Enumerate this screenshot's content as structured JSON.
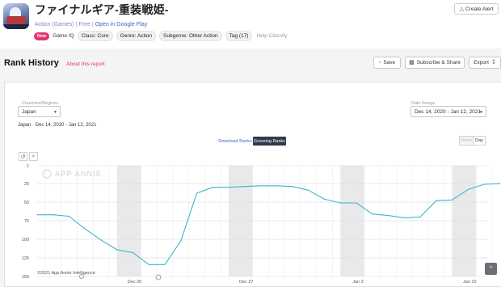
{
  "app": {
    "title": "ファイナルギア-重装戦姫-",
    "category": "Action (Games)",
    "price": "Free",
    "store_link": "Open in Google Play",
    "new_badge": "New",
    "game_iq_label": "Game IQ",
    "tags": [
      "Class: Core",
      "Genre: Action",
      "Subgenre: Other Action",
      "Tag (17)"
    ],
    "help_classify": "Help Classify",
    "create_alert": "Create Alert"
  },
  "section": {
    "title": "Rank History",
    "about": "About this report",
    "save": "Save",
    "subscribe_share": "Subscribe & Share",
    "export": "Export"
  },
  "filters": {
    "country_label": "Countries/Regions",
    "country_value": "Japan",
    "date_label": "Date Range",
    "date_value": "Dec 14, 2020 - Jan 12, 2021",
    "summary": "Japan · Dec 14, 2020 - Jan 12, 2021"
  },
  "rank_toggle": [
    "Download Ranks",
    "Grossing Ranks"
  ],
  "period": [
    "Week",
    "Day"
  ],
  "icons": {
    "alert": "bell-icon",
    "save": "bookmark-icon",
    "share": "share-icon",
    "export": "download-icon",
    "reset": "undo-icon",
    "zoom": "zoom-icon",
    "scroll": "chevron-up-icon"
  },
  "colors": {
    "line": "#3fb5c6",
    "weekend": "#e9e9ec",
    "accent": "#e6356b",
    "active_toggle": "#2f3b4a"
  },
  "chart_data": {
    "type": "line",
    "watermark": "APP ANNIE",
    "credit": "©2021 App Annie Intelligence",
    "y_inverted": true,
    "ylim": [
      1,
      150
    ],
    "y_ticks": [
      1,
      25,
      50,
      75,
      100,
      125,
      150
    ],
    "x_tick_labels": [
      "Dec 20",
      "Dec 27",
      "Jan 3",
      "Jan 10"
    ],
    "dates": [
      "Dec 14",
      "Dec 15",
      "Dec 16",
      "Dec 17",
      "Dec 18",
      "Dec 19",
      "Dec 20",
      "Dec 21",
      "Dec 22",
      "Dec 23",
      "Dec 24",
      "Dec 25",
      "Dec 26",
      "Dec 27",
      "Dec 28",
      "Dec 29",
      "Dec 30",
      "Dec 31",
      "Jan 1",
      "Jan 2",
      "Jan 3",
      "Jan 4",
      "Jan 5",
      "Jan 6",
      "Jan 7",
      "Jan 8",
      "Jan 9",
      "Jan 10",
      "Jan 11",
      "Jan 12"
    ],
    "series": [
      {
        "values": [
          67,
          67,
          69,
          86,
          101,
          114,
          118,
          134,
          134,
          102,
          38,
          30,
          30,
          29,
          28,
          28,
          29,
          34,
          46,
          51,
          51,
          66,
          68,
          71,
          70,
          48,
          47,
          33,
          26,
          25
        ]
      }
    ],
    "weekend_bands": [
      [
        "Dec 19",
        "Dec 20"
      ],
      [
        "Dec 26",
        "Dec 27"
      ],
      [
        "Jan 2",
        "Jan 3"
      ],
      [
        "Jan 9",
        "Jan 10"
      ]
    ],
    "grid": true
  }
}
